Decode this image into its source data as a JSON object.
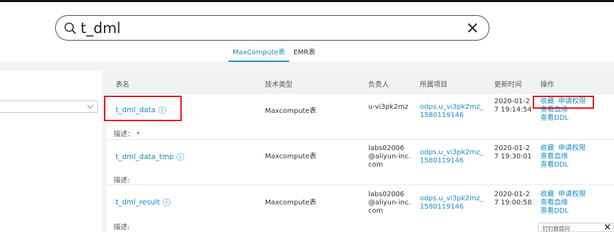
{
  "search": {
    "query": "t_dml",
    "search_icon": "search-icon",
    "clear_icon": "close-icon"
  },
  "tabs": [
    {
      "label": "MaxCompute表",
      "active": true
    },
    {
      "label": "EMR表",
      "active": false
    }
  ],
  "table": {
    "headers": [
      "表名",
      "技术类型",
      "负责人",
      "所属项目",
      "更新时间",
      "操作"
    ],
    "rows": [
      {
        "name": "t_dml_data",
        "type": "Maxcompute表",
        "owner": "u-vi3pk2mz",
        "project": "odps.u_vi3pk2mz_1580119146",
        "updated": "2020-01-27 19:14:54",
        "desc": "描述： *",
        "ops": {
          "favorite": "收藏",
          "request": "申请权限",
          "lineage": "查看血缘",
          "ddl": "查看DDL"
        }
      },
      {
        "name": "t_dml_data_tmp",
        "type": "Maxcompute表",
        "owner": "labs02006@aliyun-inc.com",
        "project": "odps.u_vi3pk2mz_1580119146",
        "updated": "2020-01-27 19:30:01",
        "desc": "描述:",
        "ops": {
          "favorite": "收藏",
          "request": "申请权限",
          "lineage": "查看血缘",
          "ddl": "查看DDL"
        }
      },
      {
        "name": "t_dml_result",
        "type": "Maxcompute表",
        "owner": "labs02006@aliyun-inc.com",
        "project": "odps.u_vi3pk2mz_1580119146",
        "updated": "2020-01-27 19:00:58",
        "desc": "描述:",
        "ops": {
          "favorite": "收藏",
          "request": "申请权限",
          "lineage": "查看血缘",
          "ddl": "查看DDL"
        }
      }
    ]
  },
  "popup": {
    "title": "钉钉群提问"
  },
  "colors": {
    "accent": "#1a8cc6",
    "highlight": "#e3141b"
  }
}
